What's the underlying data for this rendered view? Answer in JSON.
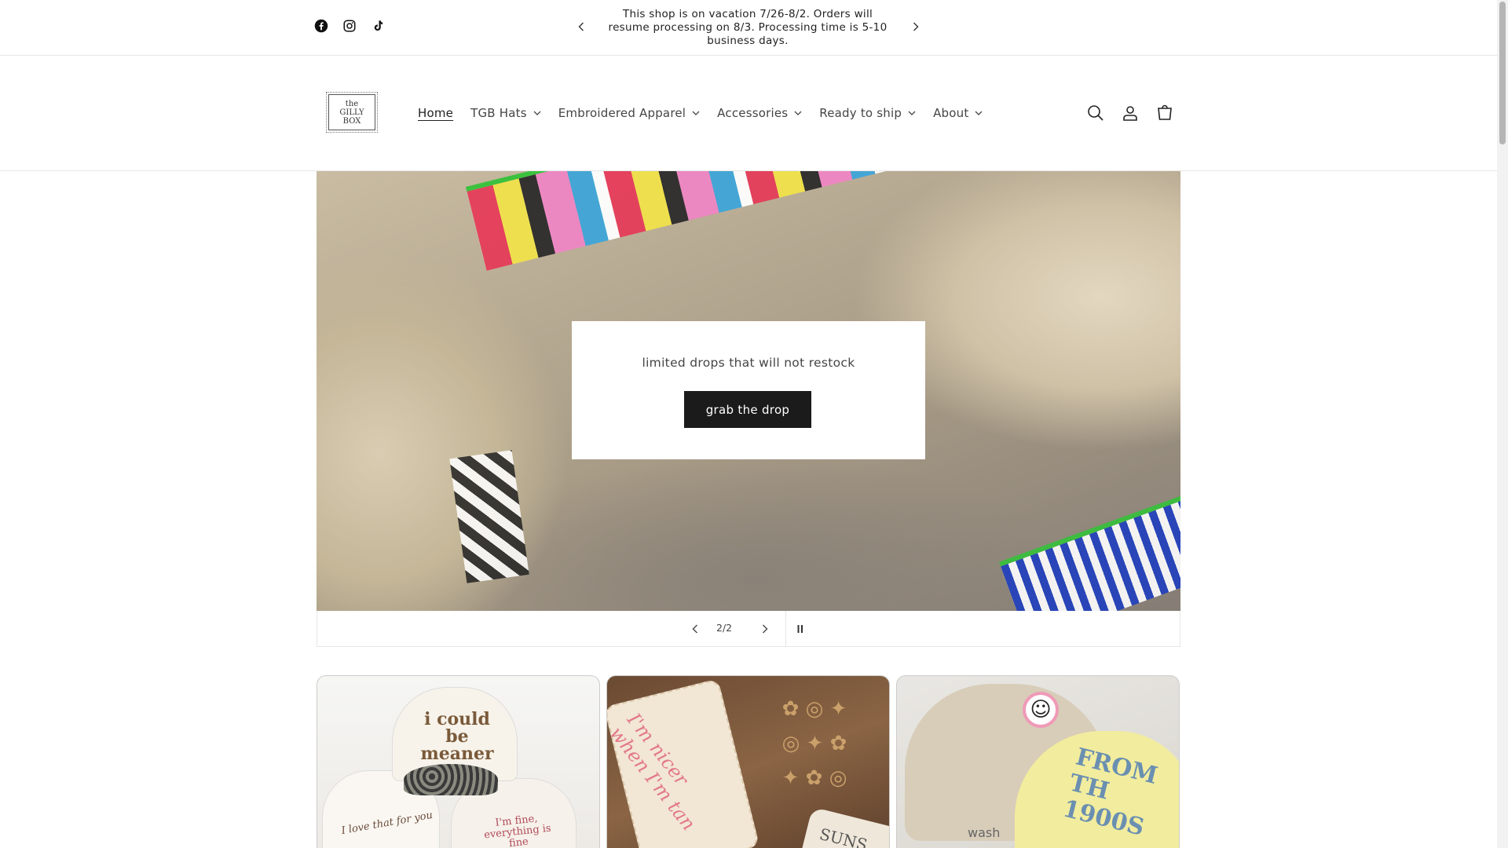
{
  "announcement": {
    "text": "This shop is on vacation 7/26-8/2. Orders will resume processing on 8/3. Processing time is 5-10 business days.",
    "social": [
      "facebook-icon",
      "instagram-icon",
      "tiktok-icon"
    ]
  },
  "header": {
    "logo_text": "the\nGILLY\nBOX",
    "nav": [
      {
        "label": "Home",
        "active": true,
        "dropdown": false
      },
      {
        "label": "TGB Hats",
        "active": false,
        "dropdown": true
      },
      {
        "label": "Embroidered Apparel",
        "active": false,
        "dropdown": true
      },
      {
        "label": "Accessories",
        "active": false,
        "dropdown": true
      },
      {
        "label": "Ready to ship",
        "active": false,
        "dropdown": true
      },
      {
        "label": "About",
        "active": false,
        "dropdown": true
      }
    ],
    "icons": [
      "search-icon",
      "account-icon",
      "cart-icon"
    ]
  },
  "hero": {
    "text": "limited drops that will not restock",
    "button_label": "grab the drop",
    "slide_counter": "2/2"
  },
  "cards": [
    {
      "hat_main": "i could be meaner",
      "hat_left": "I love that for you",
      "hat_right": "I'm fine, everything is fine"
    },
    {
      "tag_text": "I'm nicer\nwhen I'm tan",
      "tag2_text": "SUNS"
    },
    {
      "hat_text": "FROM TH\n1900S",
      "wash_text": "wash"
    }
  ]
}
